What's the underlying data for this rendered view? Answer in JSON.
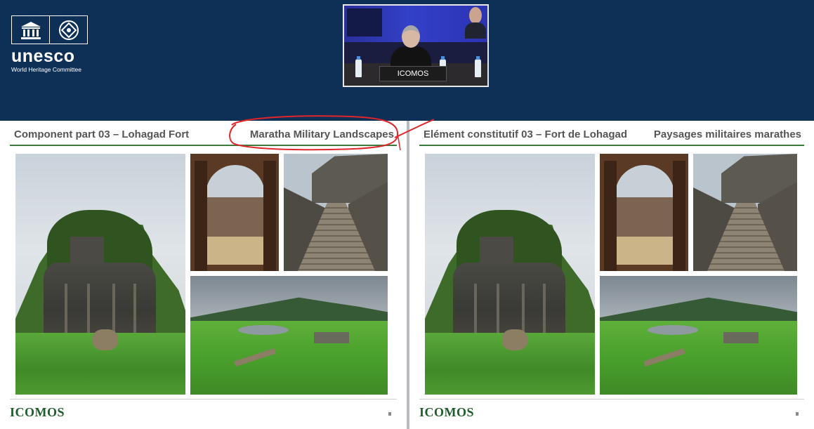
{
  "banner": {
    "logo_word": "unesco",
    "logo_subtitle": "World Heritage Committee",
    "background_color": "#0e3057",
    "icons": [
      "temple-emblem-icon",
      "world-heritage-emblem-icon"
    ]
  },
  "video": {
    "nameplate": "ICOMOS"
  },
  "slide_en": {
    "title_left": "Component part 03 – Lohagad Fort",
    "title_right": "Maratha Military Landscapes",
    "footer": "ICOMOS"
  },
  "slide_fr": {
    "title_left": "Elément constitutif 03 – Fort de Lohagad",
    "title_right": "Paysages militaires marathes",
    "footer": "ICOMOS"
  },
  "colors": {
    "accent_green": "#3d7a3d",
    "footer_green": "#1f5c2b",
    "annotation_red": "#e0262b"
  }
}
